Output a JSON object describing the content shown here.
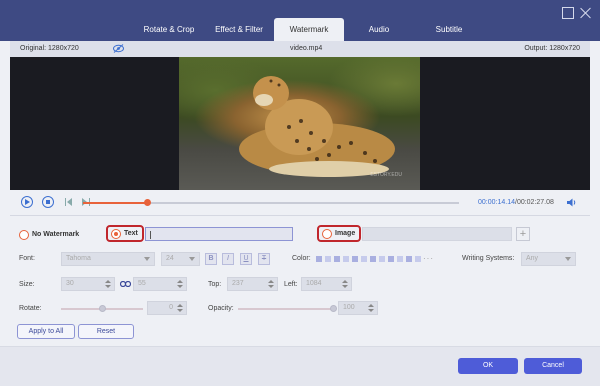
{
  "tabs": [
    {
      "label": "Rotate & Crop"
    },
    {
      "label": "Effect & Filter"
    },
    {
      "label": "Watermark"
    },
    {
      "label": "Audio"
    },
    {
      "label": "Subtitle"
    }
  ],
  "active_tab": "Watermark",
  "infobar": {
    "original": "Original: 1280x720",
    "filename": "video.mp4",
    "output": "Output: 1280x720"
  },
  "video": {
    "watermark_text": "ESTORY.EDU"
  },
  "player": {
    "current_time": "00:00:14.14",
    "separator": "/",
    "total_time": "00:02:27.08",
    "progress": 0.171
  },
  "watermark": {
    "no_watermark_label": "No Watermark",
    "text_label": "Text",
    "image_label": "Image",
    "selected": "Text",
    "text_value": "",
    "add_image_symbol": "+"
  },
  "font": {
    "label": "Font:",
    "family": "Tahoma",
    "size": "24",
    "bold": "B",
    "italic": "I",
    "underline": "U",
    "strike": "T"
  },
  "color": {
    "label": "Color:",
    "more": "···"
  },
  "writing_systems": {
    "label": "Writing Systems:",
    "value": "Any"
  },
  "size": {
    "label": "Size:",
    "width": "30",
    "height": "55"
  },
  "position": {
    "top_label": "Top:",
    "top_value": "237",
    "left_label": "Left:",
    "left_value": "1084"
  },
  "rotate": {
    "label": "Rotate:",
    "value": "0",
    "fraction": 0.5
  },
  "opacity": {
    "label": "Opacity:",
    "value": "100",
    "fraction": 1.0
  },
  "buttons": {
    "apply_all": "Apply to All",
    "reset": "Reset",
    "ok": "OK",
    "cancel": "Cancel"
  },
  "colors": {
    "accent_orange": "#e8623a",
    "highlight_red": "#c0262c",
    "brand_blue": "#4e5cd8",
    "titlebar": "#3e4a83"
  }
}
